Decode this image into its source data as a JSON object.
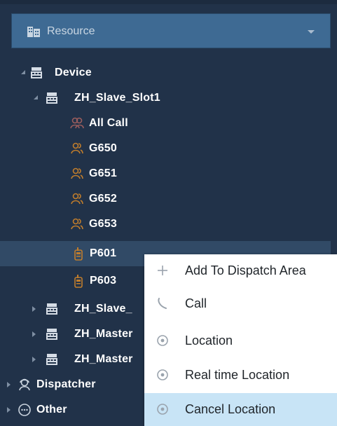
{
  "resource_dropdown": {
    "label": "Resource"
  },
  "tree": {
    "device": "Device",
    "slave_slot1": "ZH_Slave_Slot1",
    "all_call": "All Call",
    "g650": "G650",
    "g651": "G651",
    "g652": "G652",
    "g653": "G653",
    "p601": "P601",
    "p603": "P603",
    "slave_other": "ZH_Slave_",
    "master_1": "ZH_Master",
    "master_2": "ZH_Master",
    "dispatcher": "Dispatcher",
    "other": "Other"
  },
  "context_menu": {
    "items": [
      {
        "label": "Add To Dispatch Area",
        "icon": "plus-icon"
      },
      {
        "label": "Call",
        "icon": "phone-icon"
      },
      {
        "label": "Location",
        "icon": "location-icon"
      },
      {
        "label": "Real time Location",
        "icon": "location-icon"
      },
      {
        "label": "Cancel Location",
        "icon": "location-icon"
      }
    ],
    "highlighted_index": 4
  },
  "colors": {
    "panel_bg": "#213249",
    "dropdown_bg": "#3e6a93",
    "selected_row": "#314a66",
    "group_icon": "#c07d2c",
    "radio_icon": "#c07d2c",
    "menu_highlight": "#c8e4f6"
  }
}
